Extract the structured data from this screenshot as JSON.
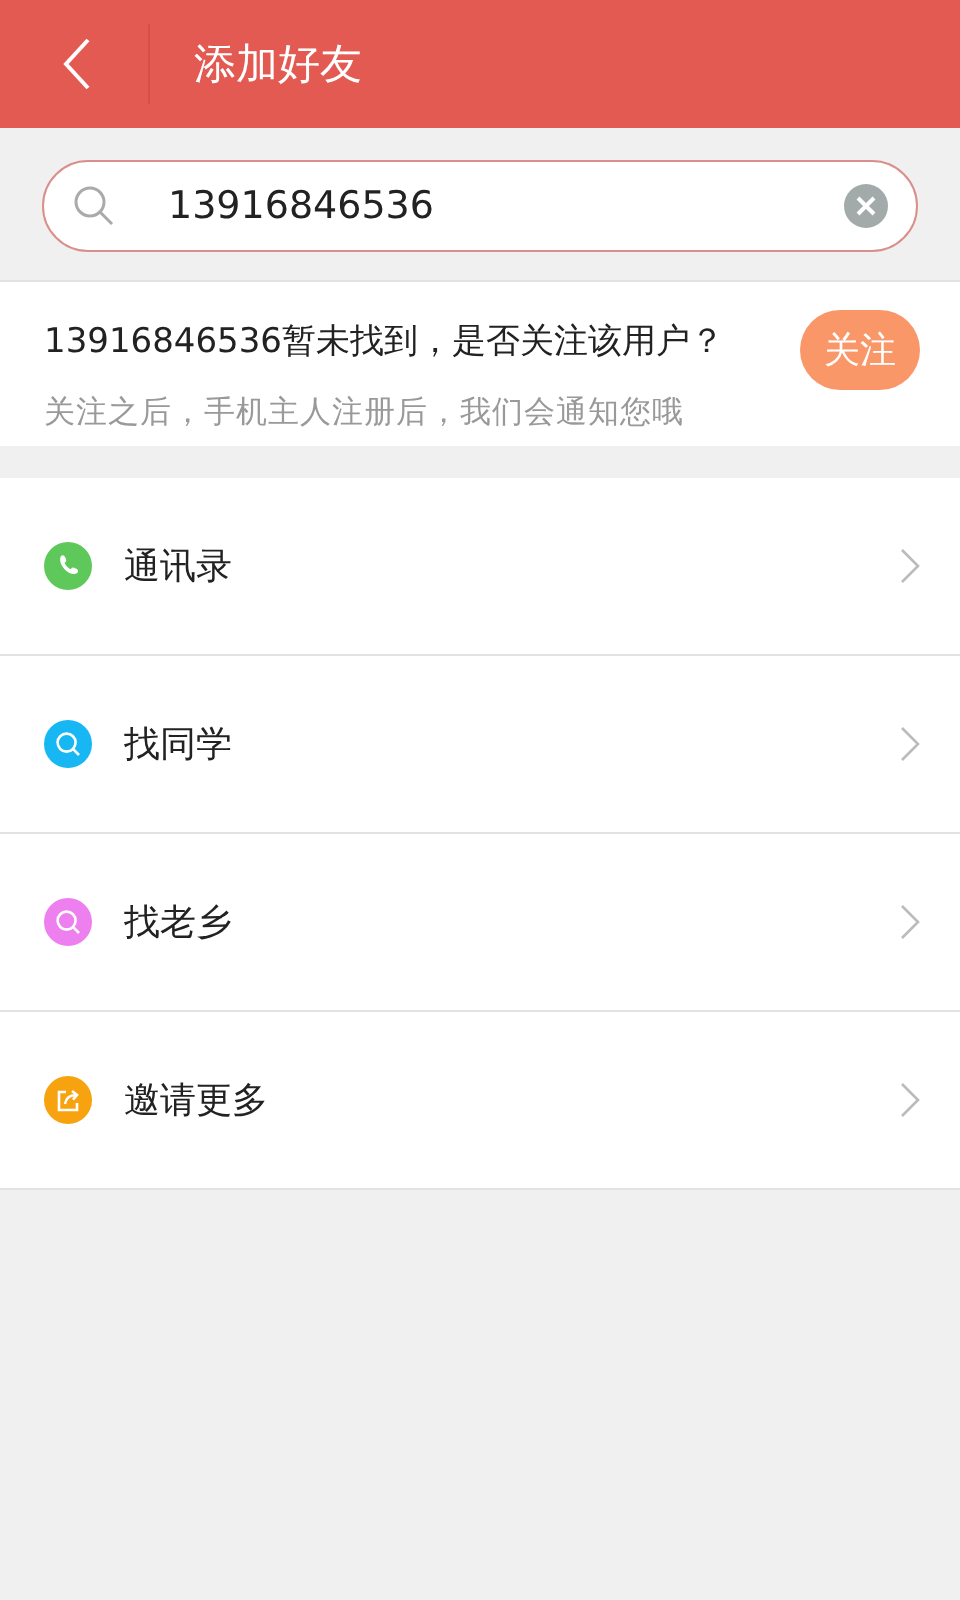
{
  "header": {
    "title": "添加好友"
  },
  "search": {
    "value": "13916846536"
  },
  "result": {
    "message": "13916846536暂未找到，是否关注该用户？",
    "hint": "关注之后，手机主人注册后，我们会通知您哦",
    "button": "关注"
  },
  "menu": [
    {
      "label": "通讯录",
      "kind": "phone",
      "color": "#5ec95a"
    },
    {
      "label": "找同学",
      "kind": "search",
      "color": "#16b7f2"
    },
    {
      "label": "找老乡",
      "kind": "search",
      "color": "#ee7fee"
    },
    {
      "label": "邀请更多",
      "kind": "share",
      "color": "#f7a30f"
    }
  ]
}
